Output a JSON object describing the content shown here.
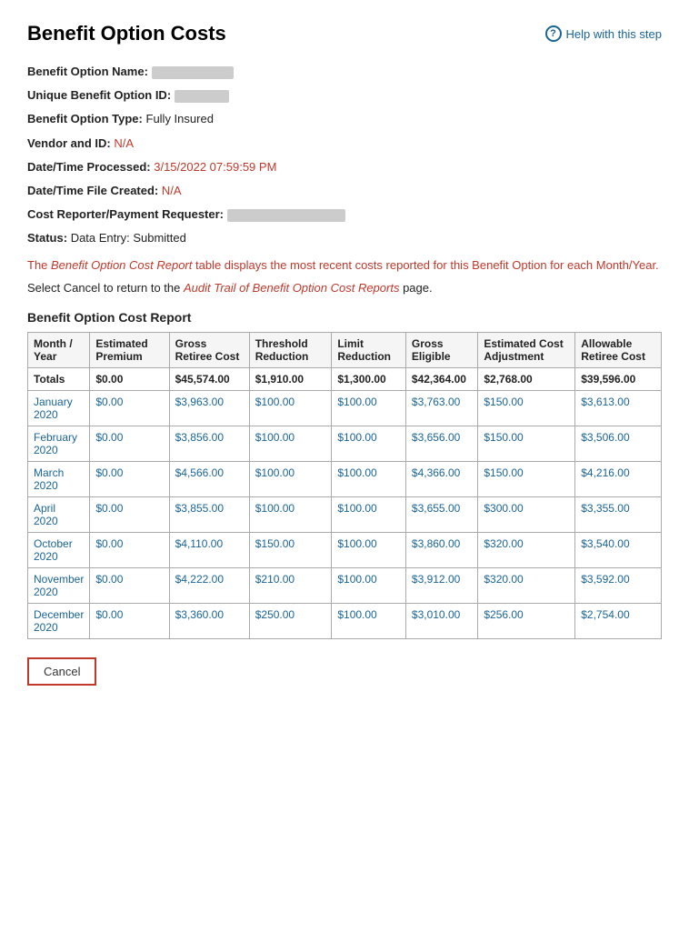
{
  "header": {
    "title": "Benefit Option Costs",
    "help_link_text": "Help with this step"
  },
  "meta": {
    "benefit_option_name_label": "Benefit Option Name:",
    "unique_id_label": "Unique Benefit Option ID:",
    "type_label": "Benefit Option Type:",
    "type_value": "Fully Insured",
    "vendor_label": "Vendor and ID:",
    "vendor_value": "N/A",
    "datetime_processed_label": "Date/Time Processed:",
    "datetime_processed_value": "3/15/2022 07:59:59 PM",
    "datetime_created_label": "Date/Time File Created:",
    "datetime_created_value": "N/A",
    "cost_reporter_label": "Cost Reporter/Payment Requester:",
    "status_label": "Status:",
    "status_value": "Data Entry: Submitted"
  },
  "info_text": "The Benefit Option Cost Report table displays the most recent costs reported for this Benefit Option for each Month/Year.",
  "instruction_text": "Select Cancel to return to the Audit Trail of Benefit Option Cost Reports page.",
  "section_title": "Benefit Option Cost Report",
  "table": {
    "headers": [
      "Month / Year",
      "Estimated Premium",
      "Gross Retiree Cost",
      "Threshold Reduction",
      "Limit Reduction",
      "Gross Eligible",
      "Estimated Cost Adjustment",
      "Allowable Retiree Cost"
    ],
    "totals": [
      "Totals",
      "$0.00",
      "$45,574.00",
      "$1,910.00",
      "$1,300.00",
      "$42,364.00",
      "$2,768.00",
      "$39,596.00"
    ],
    "rows": [
      [
        "January 2020",
        "$0.00",
        "$3,963.00",
        "$100.00",
        "$100.00",
        "$3,763.00",
        "$150.00",
        "$3,613.00"
      ],
      [
        "February 2020",
        "$0.00",
        "$3,856.00",
        "$100.00",
        "$100.00",
        "$3,656.00",
        "$150.00",
        "$3,506.00"
      ],
      [
        "March 2020",
        "$0.00",
        "$4,566.00",
        "$100.00",
        "$100.00",
        "$4,366.00",
        "$150.00",
        "$4,216.00"
      ],
      [
        "April 2020",
        "$0.00",
        "$3,855.00",
        "$100.00",
        "$100.00",
        "$3,655.00",
        "$300.00",
        "$3,355.00"
      ],
      [
        "October 2020",
        "$0.00",
        "$4,110.00",
        "$150.00",
        "$100.00",
        "$3,860.00",
        "$320.00",
        "$3,540.00"
      ],
      [
        "November 2020",
        "$0.00",
        "$4,222.00",
        "$210.00",
        "$100.00",
        "$3,912.00",
        "$320.00",
        "$3,592.00"
      ],
      [
        "December 2020",
        "$0.00",
        "$3,360.00",
        "$250.00",
        "$100.00",
        "$3,010.00",
        "$256.00",
        "$2,754.00"
      ]
    ]
  },
  "cancel_button_label": "Cancel"
}
